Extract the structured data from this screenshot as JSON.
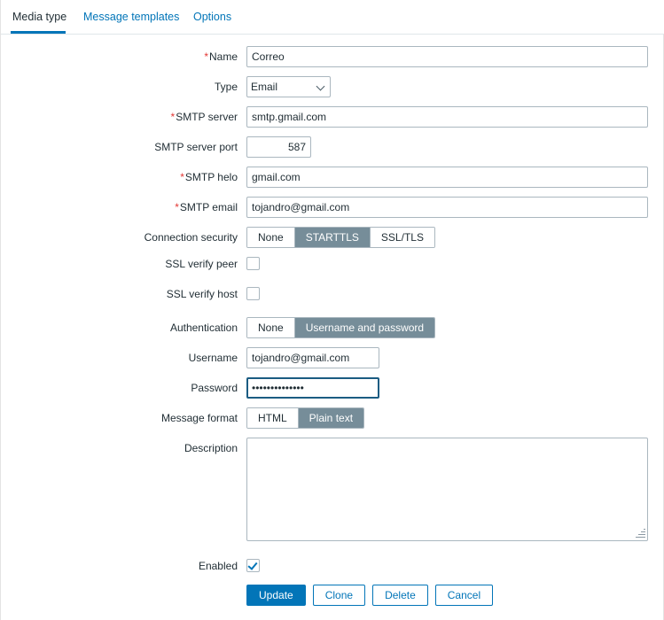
{
  "tabs": [
    {
      "label": "Media type",
      "active": true
    },
    {
      "label": "Message templates",
      "active": false
    },
    {
      "label": "Options",
      "active": false
    }
  ],
  "form": {
    "name": {
      "label": "Name",
      "required": true,
      "value": "Correo"
    },
    "type": {
      "label": "Type",
      "required": false,
      "value": "Email",
      "options": [
        "Email"
      ]
    },
    "smtp_server": {
      "label": "SMTP server",
      "required": true,
      "value": "smtp.gmail.com"
    },
    "smtp_port": {
      "label": "SMTP server port",
      "required": false,
      "value": "587"
    },
    "smtp_helo": {
      "label": "SMTP helo",
      "required": true,
      "value": "gmail.com"
    },
    "smtp_email": {
      "label": "SMTP email",
      "required": true,
      "value": "tojandro@gmail.com"
    },
    "connection_security": {
      "label": "Connection security",
      "options": [
        "None",
        "STARTTLS",
        "SSL/TLS"
      ],
      "selected": "STARTTLS"
    },
    "ssl_verify_peer": {
      "label": "SSL verify peer",
      "checked": false
    },
    "ssl_verify_host": {
      "label": "SSL verify host",
      "checked": false
    },
    "authentication": {
      "label": "Authentication",
      "options": [
        "None",
        "Username and password"
      ],
      "selected": "Username and password"
    },
    "username": {
      "label": "Username",
      "value": "tojandro@gmail.com"
    },
    "password": {
      "label": "Password",
      "value": "••••••••••••••",
      "focused": true
    },
    "message_format": {
      "label": "Message format",
      "options": [
        "HTML",
        "Plain text"
      ],
      "selected": "Plain text"
    },
    "description": {
      "label": "Description",
      "value": "",
      "placeholder": ""
    },
    "enabled": {
      "label": "Enabled",
      "checked": true
    }
  },
  "buttons": [
    {
      "label": "Update",
      "style": "primary"
    },
    {
      "label": "Clone",
      "style": "ghost"
    },
    {
      "label": "Delete",
      "style": "ghost"
    },
    {
      "label": "Cancel",
      "style": "ghost"
    }
  ],
  "colors": {
    "accent": "#0275b8",
    "segment_selected": "#768d99",
    "required_star": "#e33734",
    "border": "#aab7bf",
    "text": "#1f2c33"
  }
}
